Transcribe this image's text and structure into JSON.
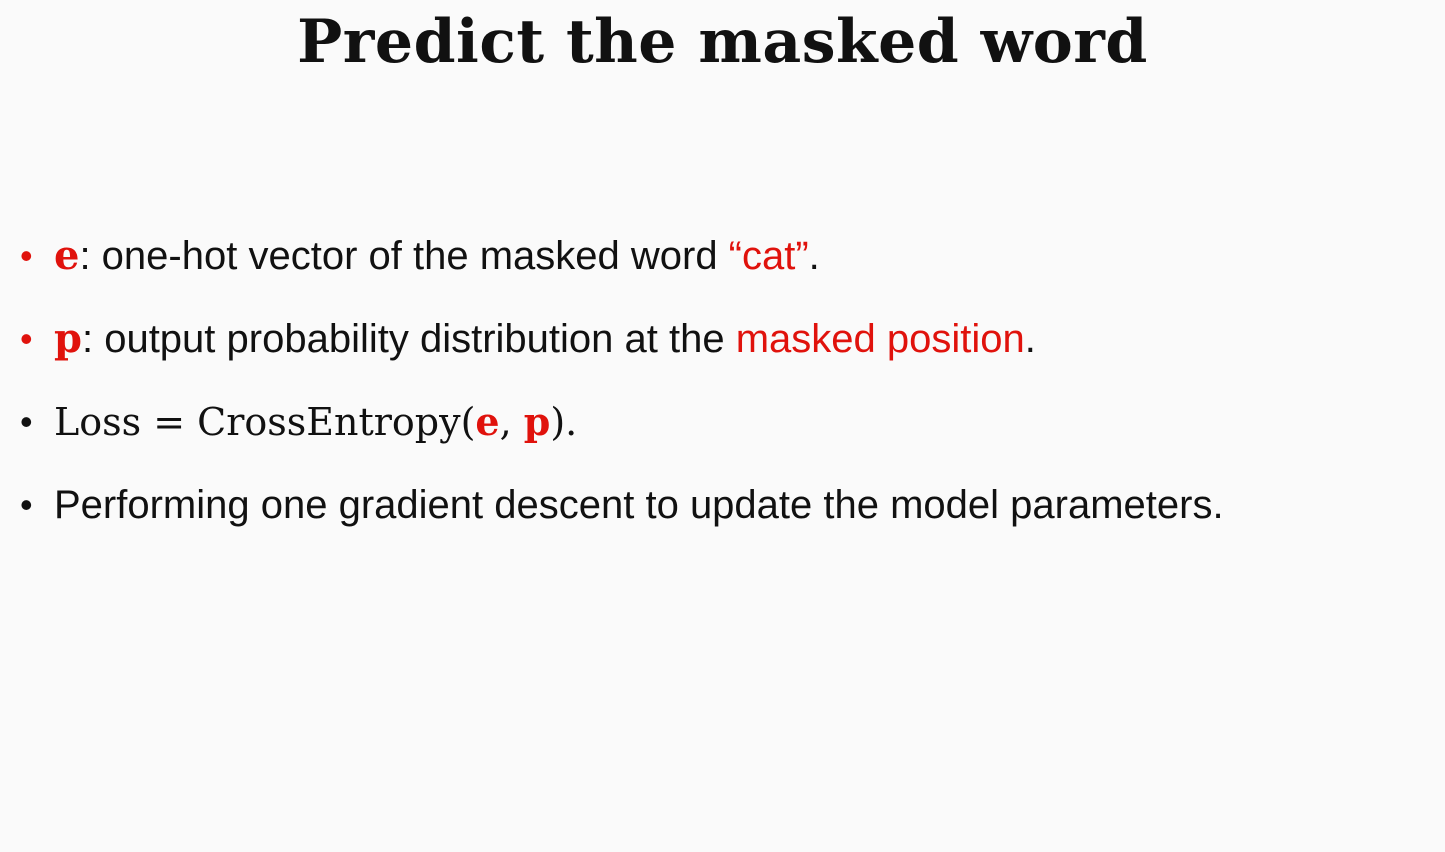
{
  "title": "Predict the masked word",
  "bullets": [
    {
      "symbol": "e",
      "text": ": one-hot vector of the masked word ",
      "highlight": "“cat”",
      "end": "."
    },
    {
      "symbol": "p",
      "text": ": output probability distribution at the ",
      "highlight": "masked position",
      "end": "."
    },
    {
      "lhs": "Loss",
      "equals": " = ",
      "func": "CrossEntropy(",
      "arg1": "e",
      "comma": ", ",
      "arg2": "p",
      "close": ")."
    },
    {
      "text": "Performing one gradient descent to update the model parameters."
    }
  ],
  "colors": {
    "accent": "#e0120c",
    "text": "#111111",
    "background": "#fafafa"
  }
}
